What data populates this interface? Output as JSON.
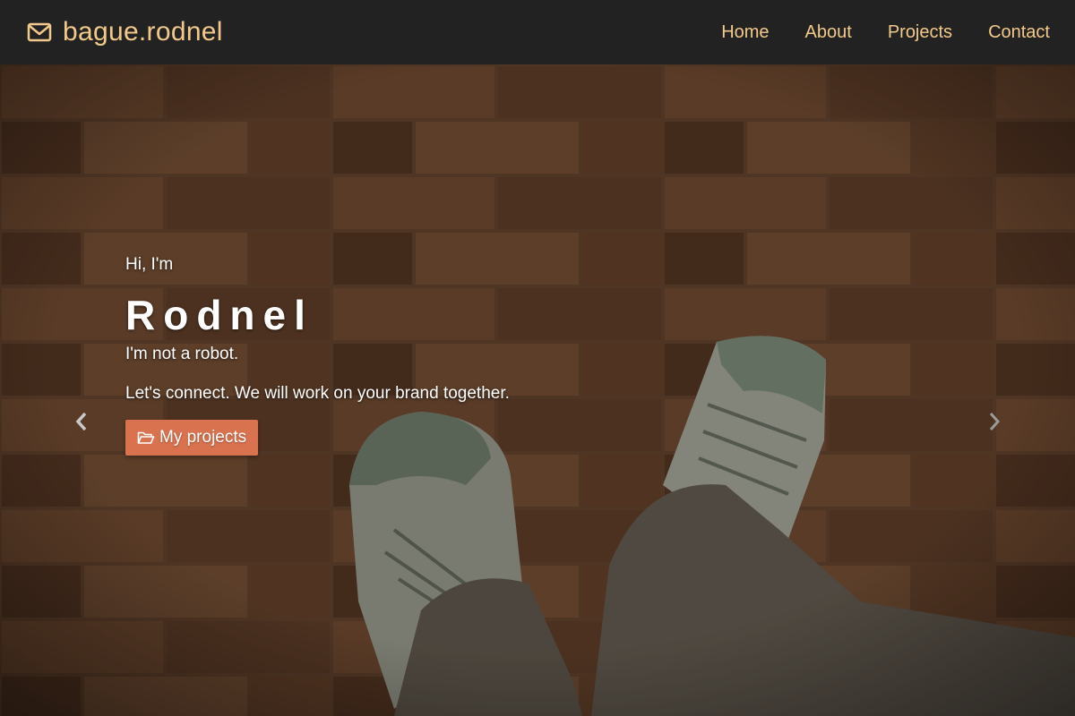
{
  "navbar": {
    "brand_icon": "envelope-icon",
    "brand_text": "bague.rodnel",
    "links": [
      "Home",
      "About",
      "Projects",
      "Contact"
    ]
  },
  "hero": {
    "greeting": "Hi, I'm",
    "name": "Rodnel",
    "tagline": "I'm not a robot.",
    "connect": "Let's connect. We will work on your brand together.",
    "cta_label": "My projects",
    "cta_icon": "folder-open-icon",
    "prev_icon": "chevron-left-icon",
    "next_icon": "chevron-right-icon",
    "background": "photo of feet in sneakers standing on wooden brick floor"
  },
  "colors": {
    "navbar_bg": "#222222",
    "nav_text": "#f3c98b",
    "cta_bg": "#d9734f"
  }
}
